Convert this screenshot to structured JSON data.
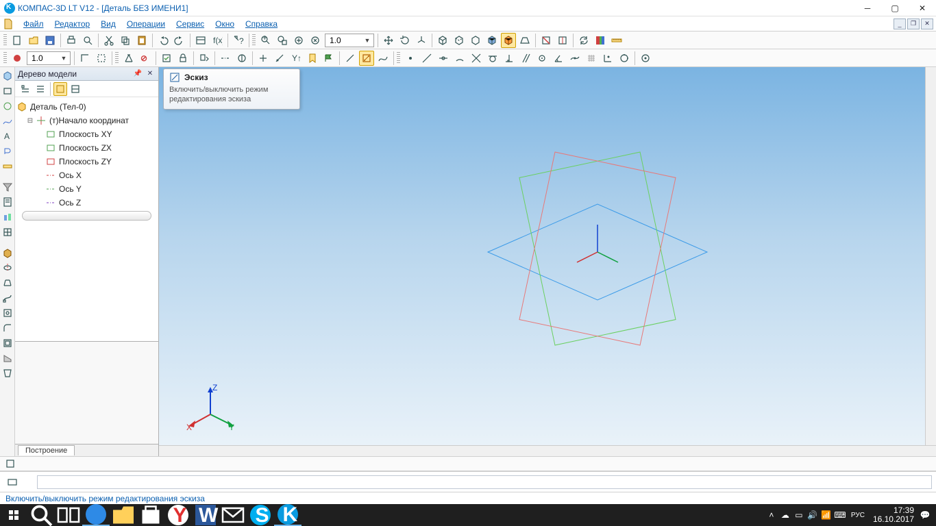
{
  "app": {
    "title": "КОМПАС-3D LT V12 - [Деталь БЕЗ ИМЕНИ1]"
  },
  "menu": {
    "items": [
      "Файл",
      "Редактор",
      "Вид",
      "Операции",
      "Сервис",
      "Окно",
      "Справка"
    ]
  },
  "toolbar1": {
    "scale_value": "1.0",
    "view_value": "1.0"
  },
  "tooltip": {
    "title": "Эскиз",
    "desc1": "Включить/выключить режим",
    "desc2": "редактирования эскиза"
  },
  "tree": {
    "panel_title": "Дерево модели",
    "root": "Деталь (Тел-0)",
    "origin": "(т)Начало координат",
    "items": [
      "Плоскость XY",
      "Плоскость ZX",
      "Плоскость ZY",
      "Ось X",
      "Ось Y",
      "Ось Z"
    ]
  },
  "mode_tab": "Построение",
  "status": "Включить/выключить режим редактирования эскиза",
  "axes": {
    "x": "X",
    "y": "Y",
    "z": "Z"
  },
  "taskbar": {
    "lang": "РУС",
    "time": "17:39",
    "date": "16.10.2017"
  }
}
